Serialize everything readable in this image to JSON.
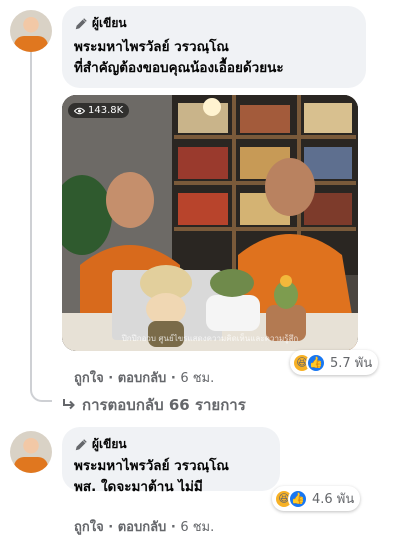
{
  "comments": [
    {
      "author_badge": "ผู้เขียน",
      "name": "พระมหาไพรวัลย์ วรวณฺโณ",
      "text": "ที่สำคัญต้องขอบคุณน้องเอื้อยด้วยนะ",
      "image": {
        "views": "143.8K",
        "watermark": "ปีกปีกอวบ ศูนย์ไขรแสดงความคิดเห็นและความรู้สึก"
      },
      "reactions": {
        "icons": [
          "haha-icon",
          "like-icon"
        ],
        "count": "5.7 พัน"
      },
      "like_label": "ถูกใจ",
      "reply_label": "ตอบกลับ",
      "time": "6 ชม.",
      "replies_label": "การตอบกลับ 66 รายการ"
    },
    {
      "author_badge": "ผู้เขียน",
      "name": "พระมหาไพรวัลย์ วรวณฺโณ",
      "text": "พส. ใดจะมาต้าน ไม่มี",
      "reactions": {
        "icons": [
          "haha-icon",
          "like-icon"
        ],
        "count": "4.6 พัน"
      },
      "like_label": "ถูกใจ",
      "reply_label": "ตอบกลับ",
      "time": "6 ชม."
    }
  ],
  "colors": {
    "bubble": "#f0f2f5",
    "muted": "#65676b",
    "like": "#1877f2",
    "haha": "#f7b125",
    "robe": "#e0771f"
  }
}
